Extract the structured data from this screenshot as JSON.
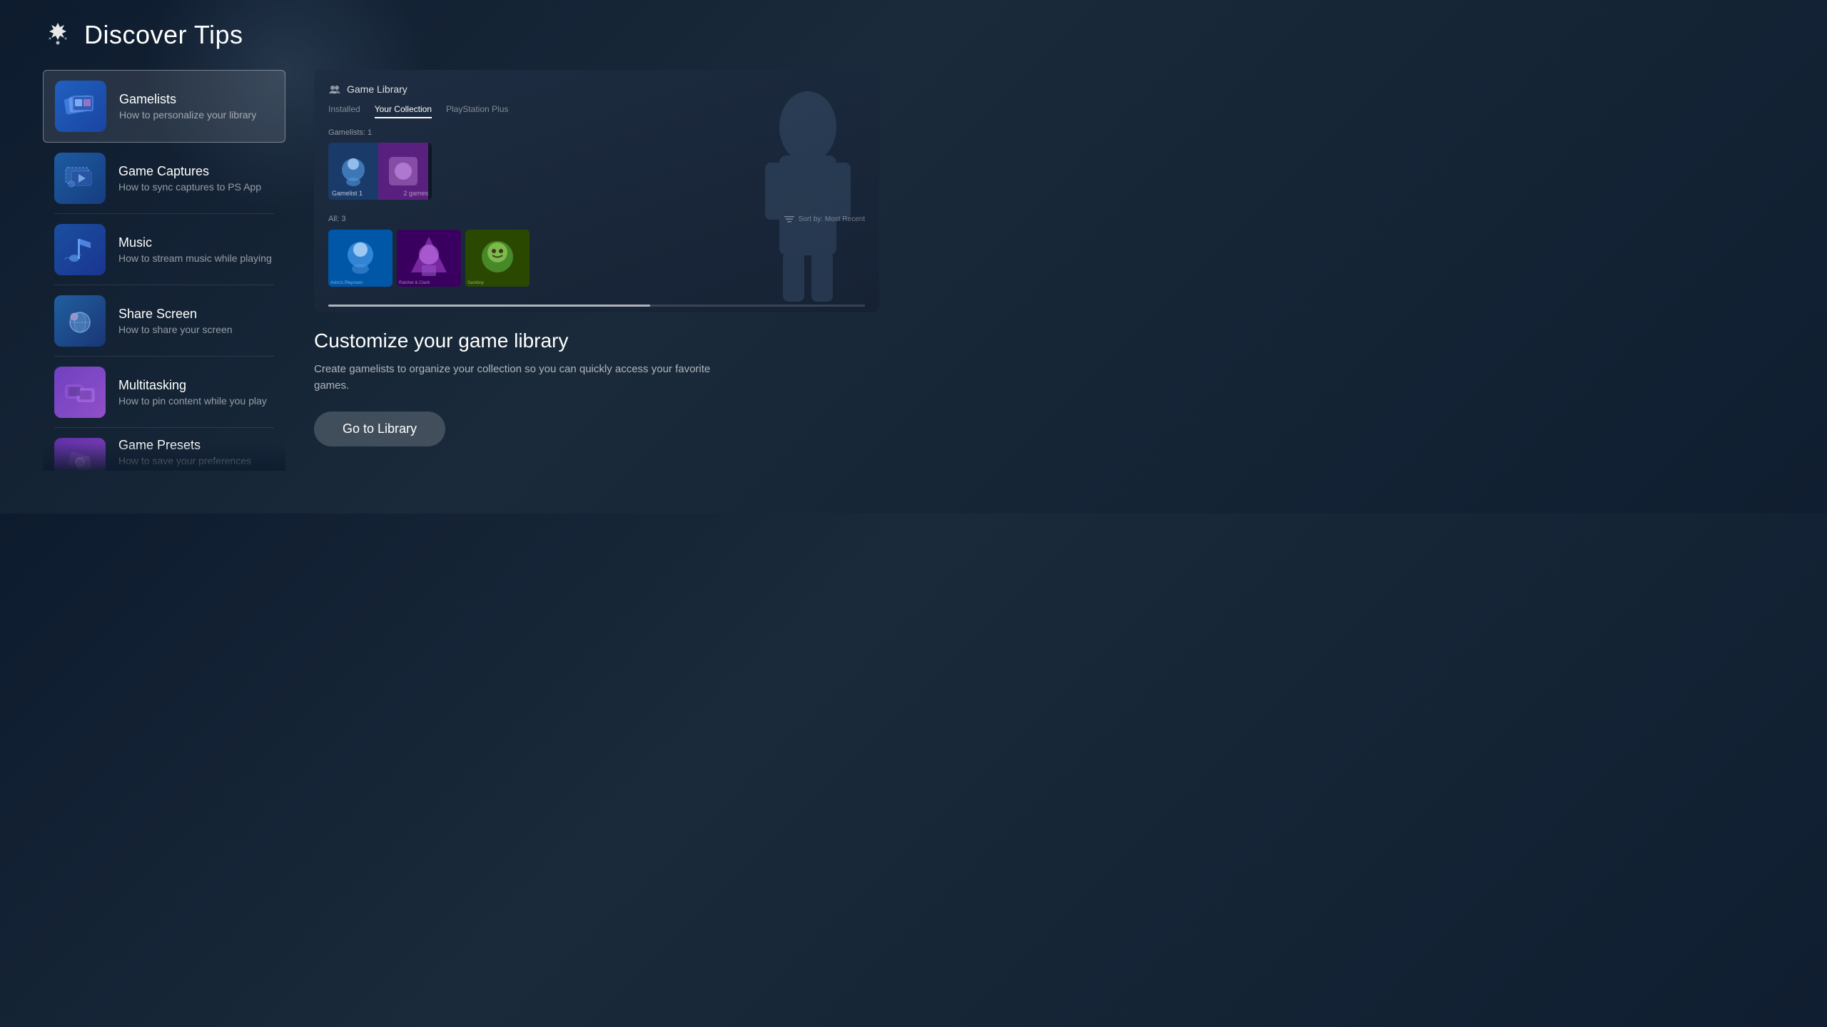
{
  "page": {
    "title": "Discover Tips",
    "header_icon": "✦"
  },
  "tips": [
    {
      "id": "gamelists",
      "title": "Gamelists",
      "subtitle": "How to personalize your library",
      "active": true
    },
    {
      "id": "game-captures",
      "title": "Game Captures",
      "subtitle": "How to sync captures to PS App",
      "active": false
    },
    {
      "id": "music",
      "title": "Music",
      "subtitle": "How to stream music while playing",
      "active": false
    },
    {
      "id": "share-screen",
      "title": "Share Screen",
      "subtitle": "How to share your screen",
      "active": false
    },
    {
      "id": "multitasking",
      "title": "Multitasking",
      "subtitle": "How to pin content while you play",
      "active": false
    },
    {
      "id": "game-presets",
      "title": "Game Presets",
      "subtitle": "How to save your preferences",
      "active": false
    }
  ],
  "preview": {
    "game_library": {
      "title": "Game Library",
      "tabs": [
        "Installed",
        "Your Collection",
        "PlayStation Plus"
      ],
      "active_tab": "Your Collection",
      "gamelists_label": "Gamelists: 1",
      "gamelist_name": "Gamelist 1",
      "gamelist_count": "2 games",
      "all_label": "All: 3",
      "sort_label": "Sort by: Most Recent",
      "games": [
        "Astro's Playroom",
        "Ratchet & Clank",
        "Sackboy"
      ]
    }
  },
  "detail": {
    "title": "Customize your game library",
    "description": "Create gamelists to organize your collection so you can quickly access your favorite games.",
    "cta_label": "Go to Library"
  }
}
